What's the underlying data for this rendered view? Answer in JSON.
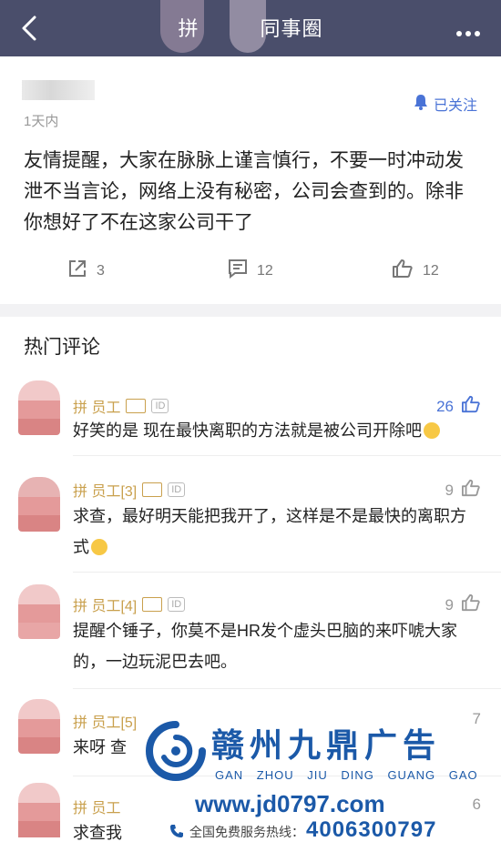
{
  "header": {
    "title_left": "拼",
    "title_right": "同事圈"
  },
  "post": {
    "time": "1天内",
    "follow_label": "已关注",
    "text": "友情提醒，大家在脉脉上谨言慎行，不要一时冲动发泄不当言论，网络上没有秘密，公司会查到的。除非你想好了不在这家公司干了",
    "share_count": "3",
    "comment_count": "12",
    "like_count": "12"
  },
  "hot_comments": {
    "title": "热门评论",
    "items": [
      {
        "name": "拼 员工",
        "likes": "26",
        "text": "好笑的是 现在最快离职的方法就是被公司开除吧"
      },
      {
        "name": "拼 员工[3]",
        "likes": "9",
        "text": "求查，最好明天能把我开了，这样是不是最快的离职方式"
      },
      {
        "name": "拼 员工[4]",
        "likes": "9",
        "text": "提醒个锤子，你莫不是HR发个虚头巴脑的来吓唬大家的，一边玩泥巴去吧。"
      },
      {
        "name": "拼 员工[5]",
        "likes": "7",
        "text": "来呀 查"
      },
      {
        "name": "拼 员工",
        "likes": "6",
        "text": "求查我"
      }
    ]
  },
  "watermark": {
    "title": "赣州九鼎广告",
    "pinyin": "GAN ZHOU JIU DING GUANG GAO",
    "url": "www.jd0797.com",
    "hotline_label": "全国免费服务热线：",
    "phone": "4006300797"
  },
  "colors": {
    "header_bg": "#4a4e6b",
    "accent": "#4a73d6",
    "gold": "#c9a04d",
    "watermark": "#1b59a8"
  }
}
